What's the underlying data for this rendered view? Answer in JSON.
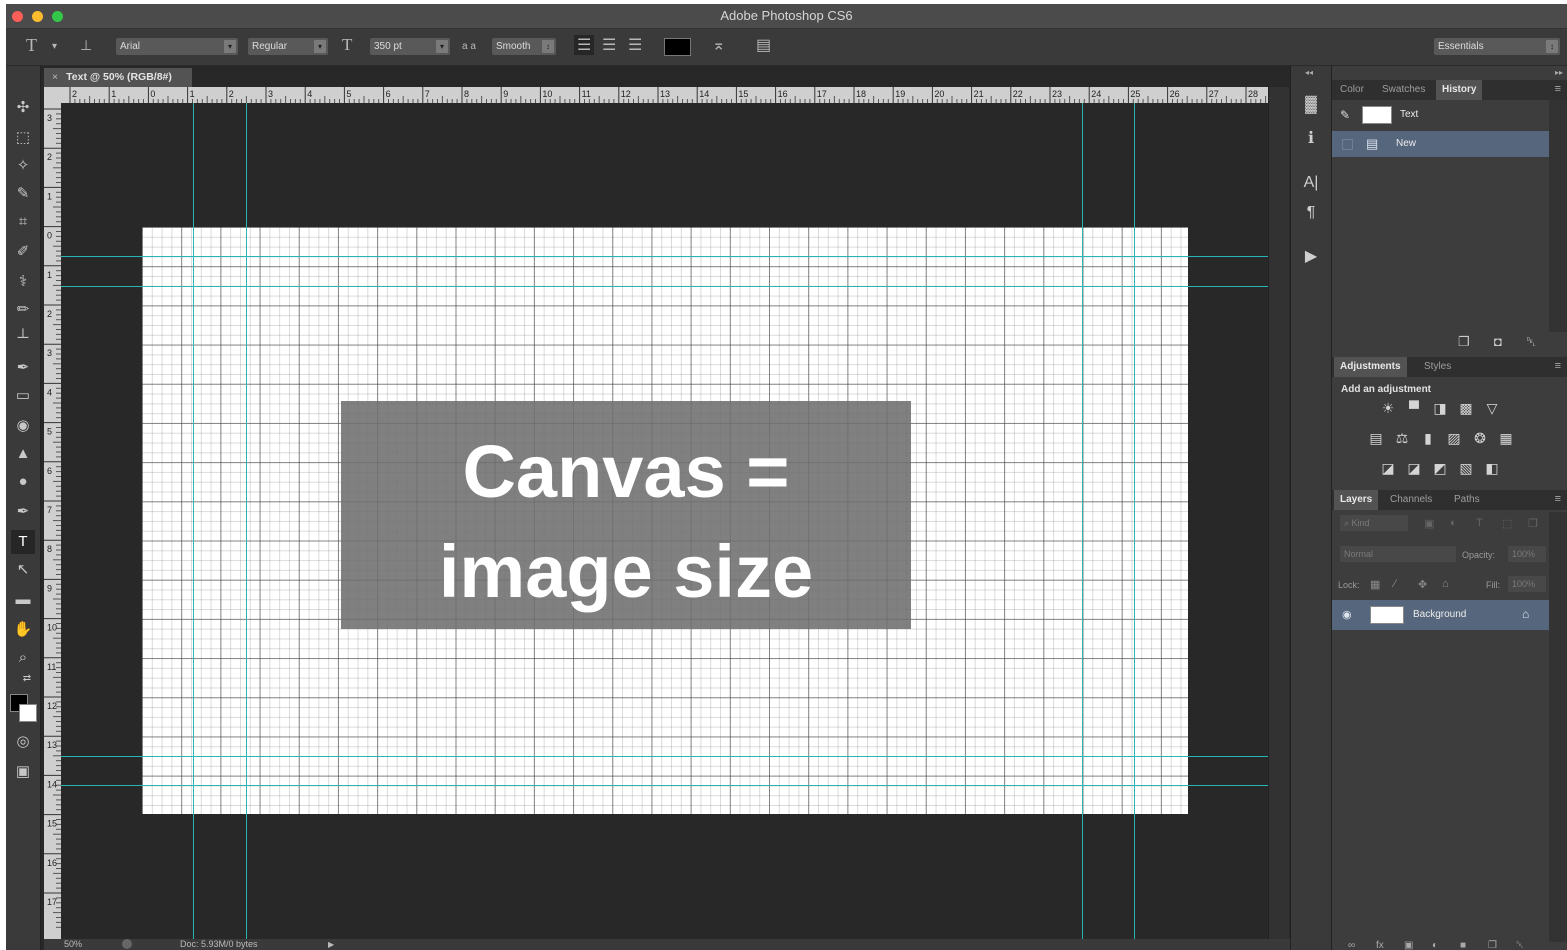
{
  "app": {
    "title": "Adobe Photoshop CS6",
    "document_tab": "Text @ 50% (RGB/8#)",
    "document_tab_close": "×"
  },
  "colors": {
    "accent_guide": "#27b5b5",
    "selected_row": "#56667d",
    "traffic_red": "#fc5f57",
    "traffic_yellow": "#fdbc2e",
    "traffic_green": "#34c84a"
  },
  "options_bar": {
    "font_family": "Arial",
    "font_style": "Regular",
    "font_size": "350 pt",
    "antialias_icon_text": "a a",
    "antialias": "Smooth",
    "workspace": "Essentials",
    "dropdown_arrow": "▾",
    "stepper_arrow": "↕",
    "text_tool_glyph": "T",
    "size_glyph": "T"
  },
  "toolbar": {
    "tools": [
      {
        "name": "move-tool-icon",
        "glyph": "✣"
      },
      {
        "name": "marquee-tool-icon",
        "glyph": "⬚"
      },
      {
        "name": "lasso-tool-icon",
        "glyph": "✧"
      },
      {
        "name": "quick-selection-tool-icon",
        "glyph": "✎"
      },
      {
        "name": "crop-tool-icon",
        "glyph": "⌗"
      },
      {
        "name": "eyedropper-tool-icon",
        "glyph": "✐"
      },
      {
        "name": "healing-brush-tool-icon",
        "glyph": "⚕"
      },
      {
        "name": "brush-tool-icon",
        "glyph": "✏"
      },
      {
        "name": "clone-stamp-tool-icon",
        "glyph": "┴"
      },
      {
        "name": "history-brush-tool-icon",
        "glyph": "✒"
      },
      {
        "name": "eraser-tool-icon",
        "glyph": "▭"
      },
      {
        "name": "paint-bucket-tool-icon",
        "glyph": "◉"
      },
      {
        "name": "blur-tool-icon",
        "glyph": "▲"
      },
      {
        "name": "dodge-tool-icon",
        "glyph": "●"
      },
      {
        "name": "pen-tool-icon",
        "glyph": "✒"
      },
      {
        "name": "type-tool-icon",
        "glyph": "T"
      },
      {
        "name": "path-selection-tool-icon",
        "glyph": "↖"
      },
      {
        "name": "rectangle-tool-icon",
        "glyph": "▬"
      },
      {
        "name": "hand-tool-icon",
        "glyph": "✋"
      },
      {
        "name": "zoom-tool-icon",
        "glyph": "⌕"
      }
    ],
    "quick_mask_glyph": "◎",
    "screen_mode_glyph": "▣",
    "swap_glyph": "⇄"
  },
  "canvas": {
    "headline_line1": "Canvas =",
    "headline_line2": "image size"
  },
  "rulers": {
    "top_labels": [
      "2",
      "1",
      "0",
      "1",
      "2",
      "3",
      "4",
      "5",
      "6",
      "7",
      "8",
      "9",
      "10",
      "11",
      "12",
      "13",
      "14",
      "15",
      "16",
      "17",
      "18",
      "19",
      "20",
      "21",
      "22",
      "23",
      "24",
      "25",
      "26",
      "27",
      "28"
    ],
    "left_labels": [
      "3",
      "2",
      "1",
      "0",
      "1",
      "2",
      "3",
      "4",
      "5",
      "6",
      "7",
      "8",
      "9",
      "10",
      "11",
      "12",
      "13",
      "14",
      "15",
      "16",
      "17"
    ]
  },
  "status": {
    "zoom": "50%",
    "doc_info": "Doc: 5.93M/0 bytes",
    "more_arrow": "▶"
  },
  "icon_strip": {
    "collapse_glyph": "◂◂",
    "items": [
      {
        "name": "histogram-panel-icon",
        "glyph": "▓"
      },
      {
        "name": "info-panel-icon",
        "glyph": "ℹ"
      },
      {
        "name": "character-panel-icon",
        "glyph": "A|"
      },
      {
        "name": "paragraph-panel-icon",
        "glyph": "¶"
      },
      {
        "name": "actions-panel-icon",
        "glyph": "▶"
      }
    ]
  },
  "history_panel": {
    "tabs": [
      "Color",
      "Swatches",
      "History"
    ],
    "active_tab": "History",
    "snapshot_label": "Text",
    "items": [
      {
        "label": "New"
      }
    ],
    "menu_glyph": "≡",
    "footer_icons": [
      "new-document-from-state-icon",
      "snapshot-camera-icon",
      "trash-icon"
    ],
    "footer_glyphs": [
      "❐",
      "◘",
      "␡"
    ]
  },
  "adjustments_panel": {
    "tabs": [
      "Adjustments",
      "Styles"
    ],
    "active_tab": "Adjustments",
    "heading": "Add an adjustment",
    "row1": [
      "☀",
      "▀",
      "◨",
      "▩",
      "▽"
    ],
    "row2": [
      "▤",
      "⚖",
      "▮",
      "▨",
      "❂",
      "▦"
    ],
    "row3": [
      "◪",
      "◪",
      "◩",
      "▧",
      "◧"
    ]
  },
  "layers_panel": {
    "tabs": [
      "Layers",
      "Channels",
      "Paths"
    ],
    "active_tab": "Layers",
    "filter_kind": "⌕ Kind",
    "blend_mode": "Normal",
    "opacity_label": "Opacity:",
    "opacity_value": "100%",
    "lock_label": "Lock:",
    "fill_label": "Fill:",
    "fill_value": "100%",
    "layer_name": "Background",
    "eye_glyph": "◉",
    "lock_glyph": "⌂",
    "filter_glyphs": [
      "▣",
      "◐",
      "T",
      "⬚",
      "❐"
    ],
    "lock_glyphs": [
      "▦",
      "∕",
      "✥",
      "⌂"
    ],
    "footer_glyphs": [
      "∞",
      "fx",
      "▣",
      "◐",
      "■",
      "❐",
      "␡"
    ]
  }
}
